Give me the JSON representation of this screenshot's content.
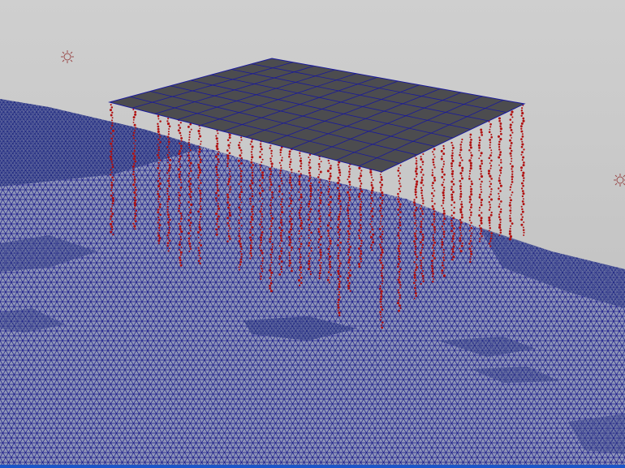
{
  "viewport": {
    "hud_label": "",
    "colors": {
      "background": "#c8c8c8",
      "background_top": "#cfcfcf",
      "ground_fill": "#8e95b8",
      "ground_wire": "#1b1b8a",
      "ground_dark": "#0e1a78",
      "plane_fill": "#4c4c4f",
      "plane_wire": "#1a1a9a",
      "particles": "#b01010",
      "light_icon": "#9a4a4a",
      "border": "#1a55c8"
    },
    "icons": {
      "light_left": "light-locator-icon",
      "light_right": "light-locator-icon"
    }
  }
}
